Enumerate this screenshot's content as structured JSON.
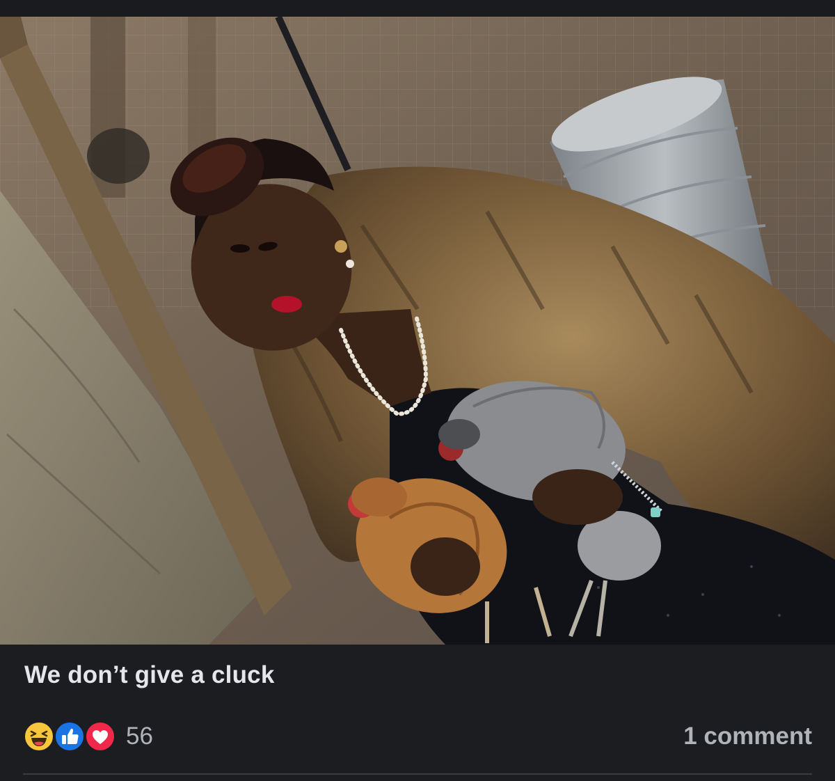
{
  "post": {
    "photo": {
      "description_icon": "photo",
      "colors": {
        "ground": "#6b5f54",
        "coat": "#6e5434",
        "coat_light": "#a88a5c",
        "dress": "#101218",
        "skin": "#3a2418",
        "hair": "#1a1010",
        "lips": "#b3122a",
        "hen_gray": "#8a8c90",
        "hen_brown": "#b5763a",
        "bin": "#9da3a8",
        "tarp": "#8e8672",
        "post": "#7a6448"
      }
    },
    "caption": "We don’t give a cluck",
    "reactions": {
      "icons": [
        "haha-icon",
        "like-icon",
        "love-icon"
      ],
      "count": "56"
    },
    "comments": {
      "label": "1 comment"
    }
  }
}
